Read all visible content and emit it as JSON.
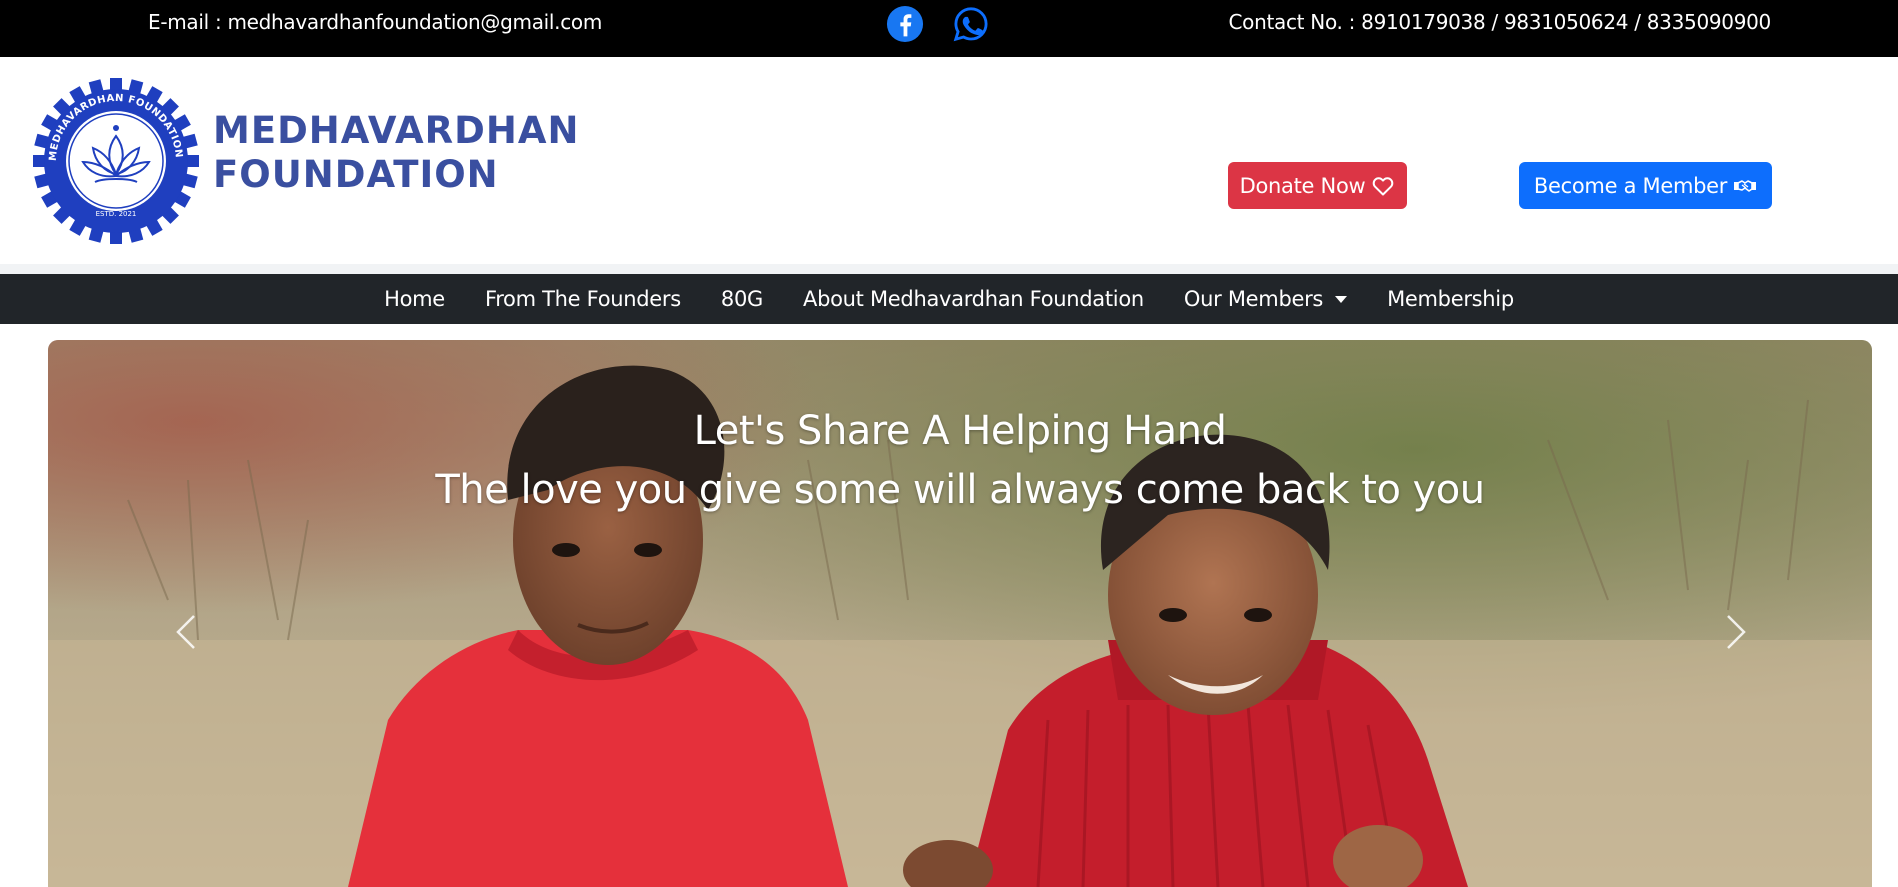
{
  "topbar": {
    "email": "E-mail : medhavardhanfoundation@gmail.com",
    "contact": "Contact No. : 8910179038 / 9831050624 / 8335090900",
    "social": [
      {
        "name": "facebook-icon",
        "color": "#1877f2"
      },
      {
        "name": "whatsapp-icon",
        "color": "#0d6efd"
      }
    ]
  },
  "header": {
    "brand_line1": "MEDHAVARDHAN",
    "brand_line2": "FOUNDATION",
    "logo_ring_text": "MEDHAVARDHAN FOUNDATION",
    "logo_estd": "ESTD. 2021",
    "donate_label": "Donate Now",
    "member_label": "Become a Member",
    "colors": {
      "brand": "#3a4fa0",
      "donate": "#dc3545",
      "member": "#0d6efd",
      "logo_ring": "#1f3fbf"
    }
  },
  "nav": {
    "items": [
      {
        "label": "Home"
      },
      {
        "label": "From The Founders"
      },
      {
        "label": "80G"
      },
      {
        "label": "About Medhavardhan Foundation"
      },
      {
        "label": "Our Members",
        "dropdown": true
      },
      {
        "label": "Membership"
      }
    ]
  },
  "carousel": {
    "heading": "Let's Share A Helping Hand",
    "subheading": "The love you give some will always come back to you",
    "prev_icon": "chevron-left-icon",
    "next_icon": "chevron-right-icon"
  }
}
